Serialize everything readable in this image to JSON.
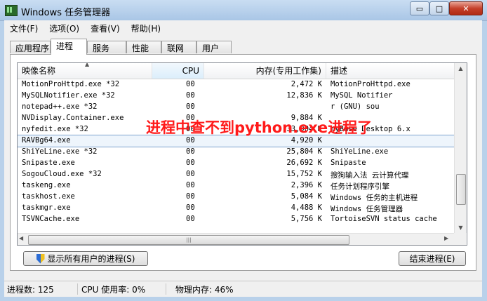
{
  "window": {
    "title": "Windows 任务管理器",
    "min_label": "▭",
    "max_label": "□",
    "close_label": "✕"
  },
  "menu": [
    "文件(F)",
    "选项(O)",
    "查看(V)",
    "帮助(H)"
  ],
  "tabs": [
    "应用程序",
    "进程",
    "服务",
    "性能",
    "联网",
    "用户"
  ],
  "active_tab": "进程",
  "columns": {
    "name": "映像名称",
    "cpu": "CPU",
    "mem": "内存(专用工作集)",
    "desc": "描述"
  },
  "processes": [
    {
      "name": "MotionProHttpd.exe *32",
      "cpu": "00",
      "mem": "2,472 K",
      "desc": "MotionProHttpd.exe"
    },
    {
      "name": "MySQLNotifier.exe *32",
      "cpu": "00",
      "mem": "12,836 K",
      "desc": "MySQL Notifier"
    },
    {
      "name": "notepad++.exe *32",
      "cpu": "00",
      "mem": "",
      "desc": "r (GNU) sou"
    },
    {
      "name": "NVDisplay.Container.exe",
      "cpu": "00",
      "mem": "9,884 K",
      "desc": ""
    },
    {
      "name": "nyfedit.exe *32",
      "cpu": "00",
      "mem": "33,904 K",
      "desc": "myBase Desktop 6.x"
    },
    {
      "name": "RAVBg64.exe",
      "cpu": "00",
      "mem": "4,920 K",
      "desc": ""
    },
    {
      "name": "ShiYeLine.exe *32",
      "cpu": "00",
      "mem": "25,804 K",
      "desc": "ShiYeLine.exe"
    },
    {
      "name": "Snipaste.exe",
      "cpu": "00",
      "mem": "26,692 K",
      "desc": "Snipaste"
    },
    {
      "name": "SogouCloud.exe *32",
      "cpu": "00",
      "mem": "15,752 K",
      "desc": "搜狗输入法 云计算代理"
    },
    {
      "name": "taskeng.exe",
      "cpu": "00",
      "mem": "2,396 K",
      "desc": "任务计划程序引擎"
    },
    {
      "name": "taskhost.exe",
      "cpu": "00",
      "mem": "5,084 K",
      "desc": "Windows 任务的主机进程"
    },
    {
      "name": "taskmgr.exe",
      "cpu": "00",
      "mem": "4,488 K",
      "desc": "Windows 任务管理器"
    },
    {
      "name": "TSVNCache.exe",
      "cpu": "00",
      "mem": "5,756 K",
      "desc": "TortoiseSVN status cache"
    }
  ],
  "annotation": "进程中查不到python.exe进程了",
  "buttons": {
    "show_all": "显示所有用户的进程(S)",
    "end_process": "结束进程(E)"
  },
  "status": {
    "process_count": "进程数: 125",
    "cpu_usage": "CPU 使用率: 0%",
    "memory": "物理内存: 46%"
  },
  "colors": {
    "annotation": "#ff1a1a",
    "selection": "#7da2ce"
  }
}
